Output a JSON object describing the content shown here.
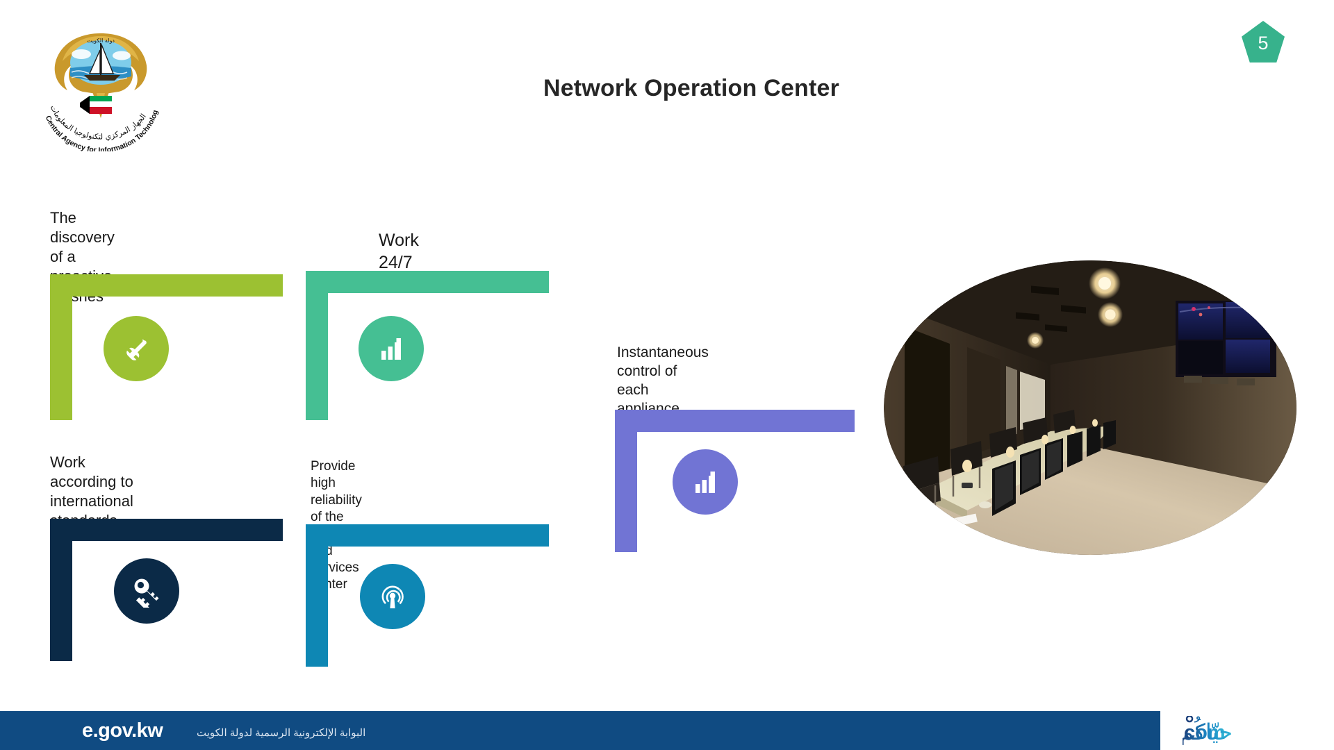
{
  "slide": {
    "title": "Network Operation Center",
    "page_number": "5",
    "page_badge_color": "#37B28C",
    "background": "#ffffff"
  },
  "logo": {
    "name": "central-agency-for-information-technology-emblem",
    "english_text": "Central Agency for Information Technology",
    "arabic_text": "الجهاز المركزي لتكنولوجيا المعلومات",
    "crest_text": "دولة الكويت"
  },
  "features": [
    {
      "id": "proactive-crashes",
      "caption": "The discovery of a\nproactive crashes",
      "color": "#9CC132",
      "icon": "wrench-screwdriver-icon",
      "caption_size": "22px"
    },
    {
      "id": "work-24-7",
      "caption": "Work 24/7",
      "color": "#45BF93",
      "icon": "bar-chart-icon",
      "caption_size": "25px"
    },
    {
      "id": "international-standards",
      "caption": "Work according to\ninternational standards",
      "color": "#0B2A47",
      "icon": "key-icon",
      "caption_size": "22px"
    },
    {
      "id": "high-reliability",
      "caption": "Provide high reliability of the\ndevices and services center",
      "color": "#0E87B4",
      "icon": "broadcast-tower-icon",
      "caption_size": "19px"
    },
    {
      "id": "instantaneous-control",
      "caption": "Instantaneous control of\neach appliance",
      "color": "#7174D4",
      "icon": "bar-chart-icon",
      "caption_size": "21px"
    }
  ],
  "photo": {
    "name": "network-operation-center-room-photo",
    "description": "Oval-cropped photo of a network operation center room with a long desk of monitors, chairs, ceiling spotlights and wall-mounted display screens"
  },
  "footer": {
    "background": "#104B82",
    "brand": "e.gov.kw",
    "arabic": "البوابة الإلكترونية الرسمية لدولة الكويت",
    "partner_logo": "hayakom-com-logo",
    "partner_arabic": "حيّاكُم",
    "partner_latin": "com"
  }
}
